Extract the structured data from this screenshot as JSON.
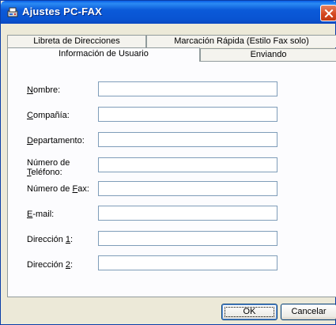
{
  "window": {
    "title": "Ajustes PC-FAX"
  },
  "tabs": {
    "back_row": [
      {
        "label": "Libreta de Direcciones"
      },
      {
        "label": "Marcación Rápida (Estilo Fax solo)"
      }
    ],
    "front_row": [
      {
        "label": "Información de Usuario",
        "active": true
      },
      {
        "label": "Enviando"
      }
    ]
  },
  "form": {
    "fields": [
      {
        "label_ul": "N",
        "label_rest": "ombre:",
        "value": ""
      },
      {
        "label_ul": "C",
        "label_rest": "ompañía:",
        "value": ""
      },
      {
        "label_ul": "D",
        "label_rest": "epartamento:",
        "value": ""
      },
      {
        "label_line1": "Número de",
        "label_ul": "T",
        "label_rest": "eléfono:",
        "value": ""
      },
      {
        "label_pre": "Número de ",
        "label_ul": "F",
        "label_rest": "ax:",
        "value": ""
      },
      {
        "label_ul": "E",
        "label_rest": "-mail:",
        "value": ""
      },
      {
        "label_pre": "Dirección ",
        "label_ul": "1",
        "label_rest": ":",
        "value": ""
      },
      {
        "label_pre": "Dirección ",
        "label_ul": "2",
        "label_rest": ":",
        "value": ""
      }
    ]
  },
  "buttons": {
    "ok": "OK",
    "cancel": "Cancelar"
  },
  "colors": {
    "titlebar": "#0a5fe8",
    "dialog_bg": "#ece9d8",
    "panel_bg": "#fcfcfe",
    "close": "#d3451f"
  },
  "icons": {
    "app": "fax-settings-icon",
    "close": "close-icon"
  }
}
